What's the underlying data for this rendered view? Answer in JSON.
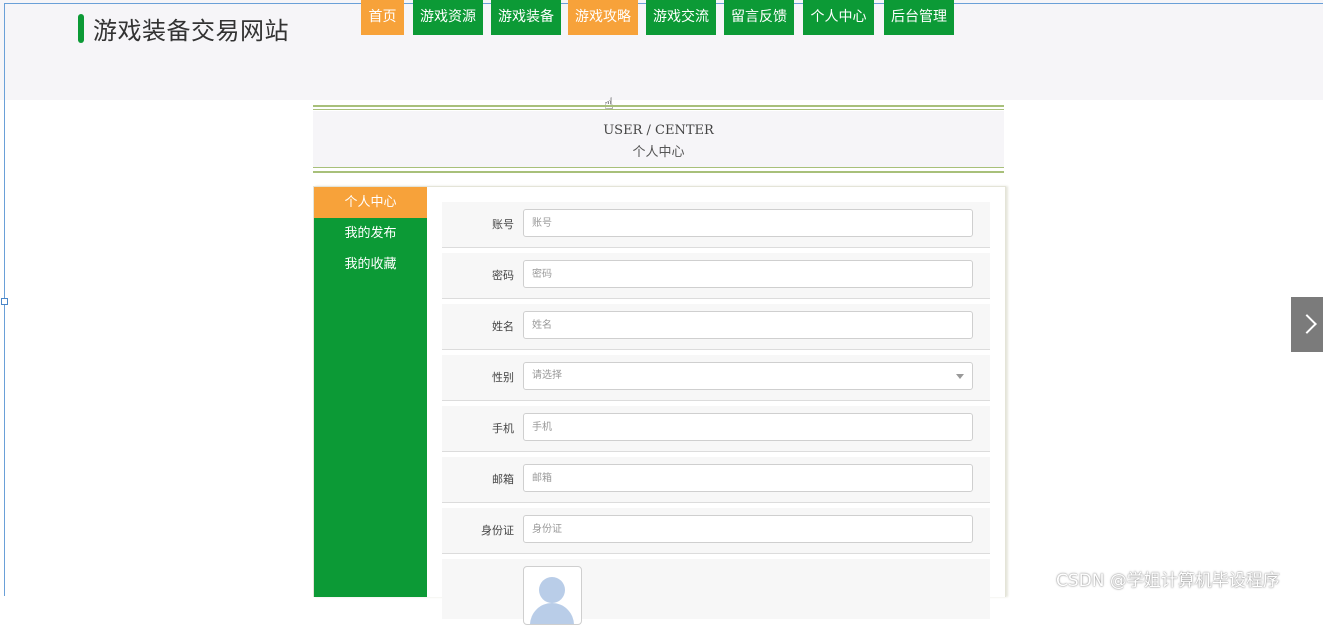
{
  "site": {
    "title": "游戏装备交易网站"
  },
  "nav": {
    "items": [
      {
        "label": "首页",
        "active": true
      },
      {
        "label": "游戏资源",
        "active": false
      },
      {
        "label": "游戏装备",
        "active": false
      },
      {
        "label": "游戏攻略",
        "active": true
      },
      {
        "label": "游戏交流",
        "active": false
      },
      {
        "label": "留言反馈",
        "active": false
      },
      {
        "label": "个人中心",
        "active": false
      },
      {
        "label": "后台管理",
        "active": false
      }
    ]
  },
  "banner": {
    "en": "USER / CENTER",
    "cn": "个人中心"
  },
  "sidebar": {
    "items": [
      {
        "label": "个人中心",
        "active": true
      },
      {
        "label": "我的发布",
        "active": false
      },
      {
        "label": "我的收藏",
        "active": false
      }
    ]
  },
  "form": {
    "fields": [
      {
        "label": "账号",
        "placeholder": "账号"
      },
      {
        "label": "密码",
        "placeholder": "密码"
      },
      {
        "label": "姓名",
        "placeholder": "姓名"
      },
      {
        "label": "性别",
        "placeholder": "请选择"
      },
      {
        "label": "手机",
        "placeholder": "手机"
      },
      {
        "label": "邮箱",
        "placeholder": "邮箱"
      },
      {
        "label": "身份证",
        "placeholder": "身份证"
      }
    ]
  },
  "watermark": "CSDN @学姐计算机毕设程序",
  "colors": {
    "green": "#0c9a36",
    "orange": "#f7a23a",
    "banner_line": "#a8c07a"
  },
  "icons": {
    "next": "chevron-right-icon",
    "avatar": "avatar-placeholder-icon",
    "cursor": "hand-pointer-icon"
  }
}
